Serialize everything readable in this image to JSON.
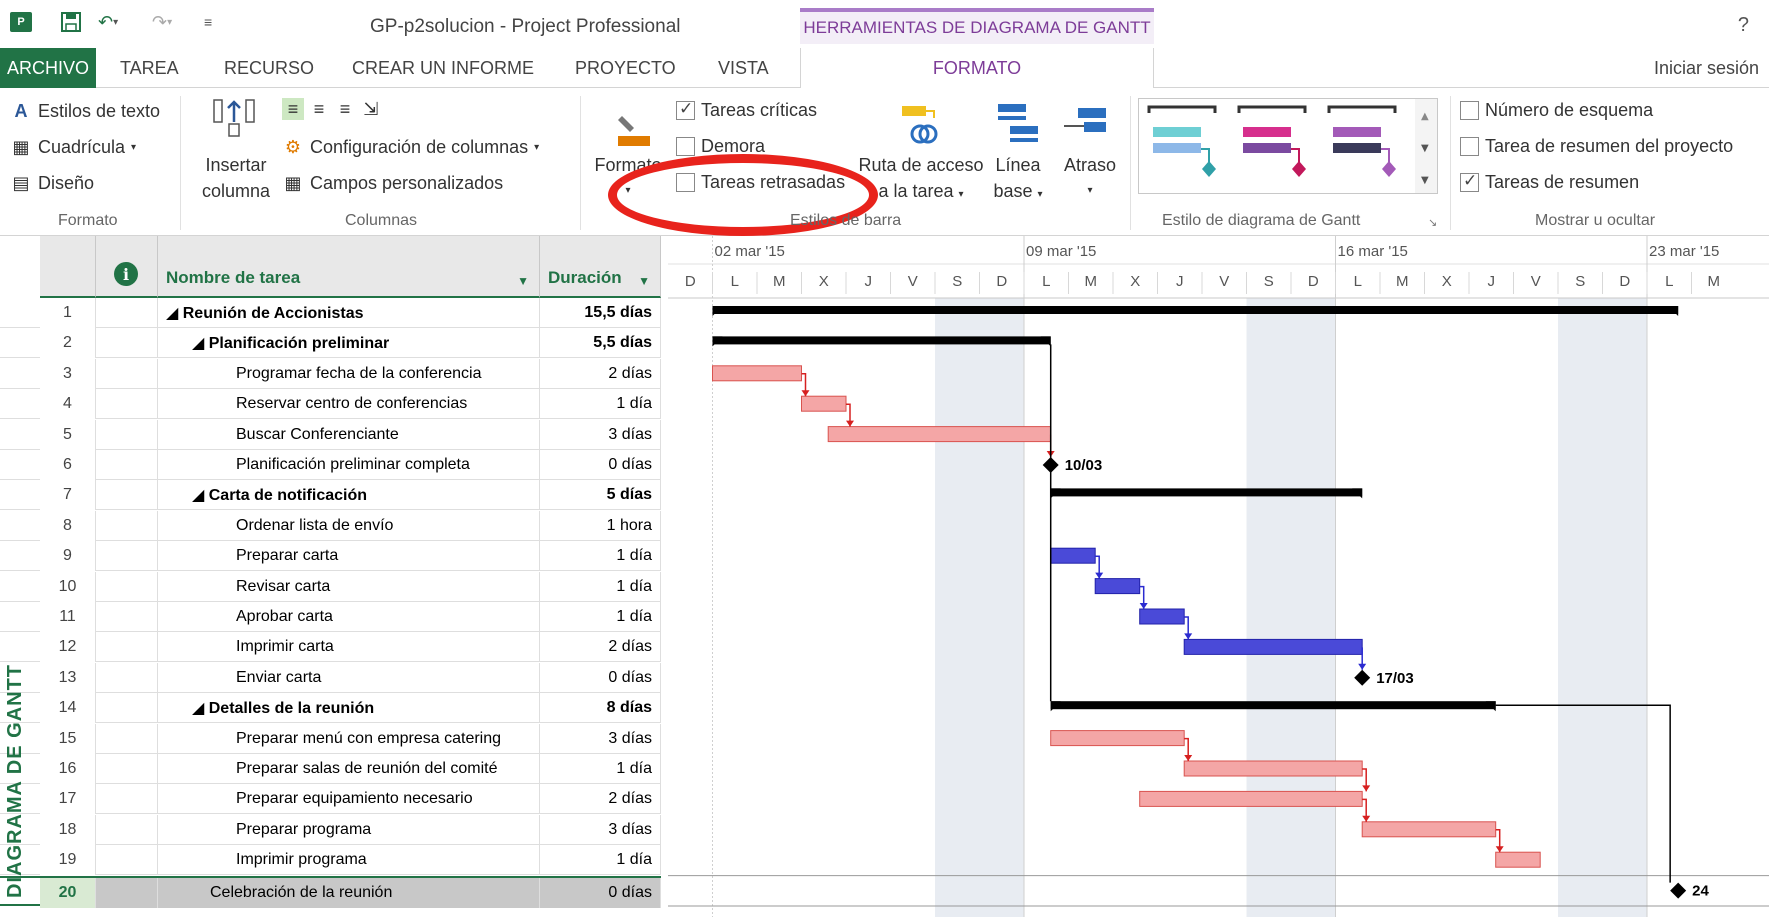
{
  "app": {
    "title": "GP-p2solucion - Project Professional",
    "contextual_tab": "HERRAMIENTAS DE DIAGRAMA DE GANTT",
    "help": "?"
  },
  "tabs": {
    "file": "ARCHIVO",
    "task": "TAREA",
    "resource": "RECURSO",
    "report": "CREAR UN INFORME",
    "project": "PROYECTO",
    "view": "VISTA",
    "format": "FORMATO",
    "signin": "Iniciar sesión"
  },
  "ribbon": {
    "format_group": {
      "text_styles": "Estilos de texto",
      "gridlines": "Cuadrícula",
      "layout": "Diseño",
      "label": "Formato"
    },
    "columns_group": {
      "insert_column_1": "Insertar",
      "insert_column_2": "columna",
      "column_settings": "Configuración de columnas",
      "custom_fields": "Campos personalizados",
      "label": "Columnas"
    },
    "bar_styles_group": {
      "format_1": "Formato",
      "critical_tasks": "Tareas críticas",
      "slack": "Demora",
      "late_tasks": "Tareas retrasadas",
      "task_path_1": "Ruta de acceso",
      "task_path_2": "a la tarea",
      "baseline_1": "Línea",
      "baseline_2": "base",
      "slippage": "Atraso",
      "label": "Estilos de barra"
    },
    "gantt_style_group": {
      "label": "Estilo de diagrama de Gantt"
    },
    "show_hide_group": {
      "outline_number": "Número de esquema",
      "project_summary": "Tarea de resumen del proyecto",
      "summary_tasks": "Tareas de resumen",
      "label": "Mostrar u ocultar"
    }
  },
  "checkboxes": {
    "critical_tasks": true,
    "slack": false,
    "late_tasks": false,
    "outline_number": false,
    "project_summary": false,
    "summary_tasks": true
  },
  "table": {
    "headers": {
      "name": "Nombre de tarea",
      "duration": "Duración"
    },
    "rows": [
      {
        "id": "1",
        "name": "◢ Reunión de Accionistas",
        "duration": "15,5 días",
        "level": 0,
        "summary": true
      },
      {
        "id": "2",
        "name": "◢ Planificación preliminar",
        "duration": "5,5 días",
        "level": 1,
        "summary": true
      },
      {
        "id": "3",
        "name": "Programar fecha de la conferencia",
        "duration": "2 días",
        "level": 2,
        "summary": false
      },
      {
        "id": "4",
        "name": "Reservar centro de conferencias",
        "duration": "1 día",
        "level": 2,
        "summary": false
      },
      {
        "id": "5",
        "name": "Buscar Conferenciante",
        "duration": "3 días",
        "level": 2,
        "summary": false
      },
      {
        "id": "6",
        "name": "Planificación preliminar completa",
        "duration": "0 días",
        "level": 2,
        "summary": false
      },
      {
        "id": "7",
        "name": "◢ Carta de notificación",
        "duration": "5 días",
        "level": 1,
        "summary": true
      },
      {
        "id": "8",
        "name": "Ordenar lista de envío",
        "duration": "1 hora",
        "level": 2,
        "summary": false
      },
      {
        "id": "9",
        "name": "Preparar carta",
        "duration": "1 día",
        "level": 2,
        "summary": false
      },
      {
        "id": "10",
        "name": "Revisar carta",
        "duration": "1 día",
        "level": 2,
        "summary": false
      },
      {
        "id": "11",
        "name": "Aprobar carta",
        "duration": "1 día",
        "level": 2,
        "summary": false
      },
      {
        "id": "12",
        "name": "Imprimir carta",
        "duration": "2 días",
        "level": 2,
        "summary": false
      },
      {
        "id": "13",
        "name": "Enviar carta",
        "duration": "0 días",
        "level": 2,
        "summary": false
      },
      {
        "id": "14",
        "name": "◢ Detalles de la reunión",
        "duration": "8 días",
        "level": 1,
        "summary": true
      },
      {
        "id": "15",
        "name": "Preparar menú con empresa catering",
        "duration": "3 días",
        "level": 2,
        "summary": false
      },
      {
        "id": "16",
        "name": "Preparar salas de reunión del comité",
        "duration": "1 día",
        "level": 2,
        "summary": false
      },
      {
        "id": "17",
        "name": "Preparar equipamiento necesario",
        "duration": "2 días",
        "level": 2,
        "summary": false
      },
      {
        "id": "18",
        "name": "Preparar programa",
        "duration": "3 días",
        "level": 2,
        "summary": false
      },
      {
        "id": "19",
        "name": "Imprimir programa",
        "duration": "1 día",
        "level": 2,
        "summary": false
      },
      {
        "id": "20",
        "name": "Celebración de la reunión",
        "duration": "0 días",
        "level": 1,
        "summary": false,
        "selected": true
      }
    ]
  },
  "timescale": {
    "weeks": [
      "02 mar '15",
      "09 mar '15",
      "16 mar '15",
      "23 mar '15"
    ],
    "days": [
      "D",
      "L",
      "M",
      "X",
      "J",
      "V",
      "S",
      "D",
      "L",
      "M",
      "X",
      "J",
      "V",
      "S",
      "D",
      "L",
      "M",
      "X",
      "J",
      "V",
      "S",
      "D",
      "L",
      "M"
    ]
  },
  "gantt": {
    "milestone_labels": {
      "m6": "10/03",
      "m13": "17/03",
      "m20": "24"
    },
    "colors": {
      "critical": "#f4a6a6",
      "critical_border": "#d9534f",
      "blue": "#4a4ad8",
      "summary": "#000000",
      "weekend": "#e8ecf2"
    },
    "bars": [
      {
        "row": 0,
        "type": "summary",
        "start": 1.0,
        "end": 22.7
      },
      {
        "row": 1,
        "type": "summary",
        "start": 1.0,
        "end": 8.6
      },
      {
        "row": 2,
        "type": "critical",
        "start": 1.0,
        "end": 3.0
      },
      {
        "row": 3,
        "type": "critical",
        "start": 3.0,
        "end": 4.0
      },
      {
        "row": 4,
        "type": "critical",
        "start": 3.6,
        "end": 8.6
      },
      {
        "row": 5,
        "type": "milestone",
        "start": 8.6
      },
      {
        "row": 6,
        "type": "summary",
        "start": 8.6,
        "end": 15.6
      },
      {
        "row": 8,
        "type": "blue",
        "start": 8.6,
        "end": 9.6
      },
      {
        "row": 9,
        "type": "blue",
        "start": 9.6,
        "end": 10.6
      },
      {
        "row": 10,
        "type": "blue",
        "start": 10.6,
        "end": 11.6
      },
      {
        "row": 11,
        "type": "blue",
        "start": 11.6,
        "end": 15.6
      },
      {
        "row": 12,
        "type": "milestone",
        "start": 15.6
      },
      {
        "row": 13,
        "type": "summary",
        "start": 8.6,
        "end": 18.6
      },
      {
        "row": 14,
        "type": "critical",
        "start": 8.6,
        "end": 11.6
      },
      {
        "row": 15,
        "type": "critical",
        "start": 11.6,
        "end": 15.6
      },
      {
        "row": 16,
        "type": "critical",
        "start": 10.6,
        "end": 15.6
      },
      {
        "row": 17,
        "type": "critical",
        "start": 15.6,
        "end": 18.6
      },
      {
        "row": 18,
        "type": "critical",
        "start": 18.6,
        "end": 19.6
      },
      {
        "row": 19,
        "type": "milestone",
        "start": 22.7
      }
    ]
  },
  "view_label": "DIAGRAMA DE GANTT"
}
